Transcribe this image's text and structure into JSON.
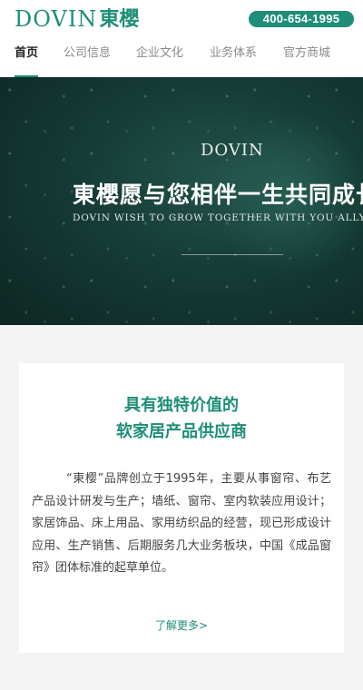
{
  "header": {
    "logo_latin": "DOVIN",
    "logo_cn": "東櫻",
    "phone": "400-654-1995"
  },
  "nav": {
    "items": [
      "首页",
      "公司信息",
      "企业文化",
      "业务体系",
      "官方商城"
    ],
    "active_index": 0
  },
  "banner": {
    "logo": "DOVIN",
    "title": "東櫻愿与您相伴一生共同成长",
    "subtitle": "DOVIN WISH TO GROW TOGETHER WITH YOU ALLYOUR LIFE"
  },
  "intro": {
    "title_line1": "具有独特价值的",
    "title_line2": "软家居产品供应商",
    "body": "“東樱”品牌创立于1995年，主要从事窗帘、布艺产品设计研发与生产；墙纸、窗帘、室内软装应用设计；家居饰品、床上用品、家用纺织品的经营，现已形成设计应用、生产销售、后期服务几大业务板块，中国《成品窗帘》团体标准的起草单位。",
    "more_link": "了解更多>"
  },
  "colors": {
    "brand": "#1f8e78",
    "banner_dark": "#0d2622"
  }
}
